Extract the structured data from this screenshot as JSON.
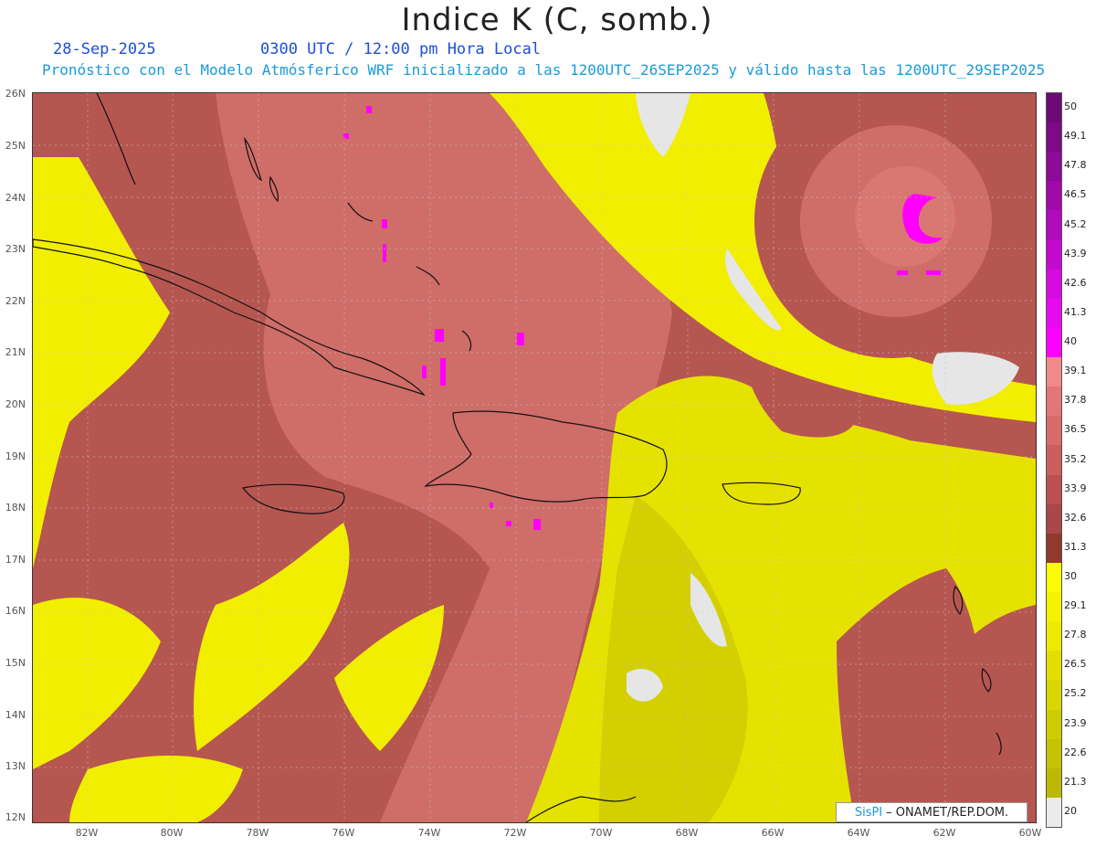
{
  "header": {
    "title": "Indice K (C, somb.)",
    "date": "28-Sep-2025",
    "time": "0300 UTC / 12:00 pm Hora Local",
    "forecast": "Pronóstico con el Modelo Atmósferico WRF inicializado a las 1200UTC_26SEP2025 y válido hasta las  1200UTC_29SEP2025"
  },
  "axes": {
    "lat_labels": [
      "26N",
      "25N",
      "24N",
      "23N",
      "22N",
      "21N",
      "20N",
      "19N",
      "18N",
      "17N",
      "16N",
      "15N",
      "14N",
      "13N",
      "12N"
    ],
    "lon_labels": [
      "82W",
      "80W",
      "78W",
      "76W",
      "74W",
      "72W",
      "70W",
      "68W",
      "66W",
      "64W",
      "62W",
      "60W"
    ]
  },
  "colorbar": {
    "labels": [
      "50",
      "49.1",
      "47.8",
      "46.5",
      "45.2",
      "43.9",
      "42.6",
      "41.3",
      "40",
      "39.1",
      "37.8",
      "36.5",
      "35.2",
      "33.9",
      "32.6",
      "31.3",
      "30",
      "29.1",
      "27.8",
      "26.5",
      "25.2",
      "23.9",
      "22.6",
      "21.3",
      "20"
    ],
    "colors": [
      "#6e0a78",
      "#7d0a86",
      "#8e0a98",
      "#a00aaa",
      "#b20abd",
      "#c50ad0",
      "#d70ae0",
      "#e70af0",
      "#ff00ff",
      "#f08a8a",
      "#e37676",
      "#d96a6a",
      "#cc5e5e",
      "#bc5050",
      "#a84848",
      "#8f3a2a",
      "#fffb00",
      "#f5f200",
      "#ecea00",
      "#e2df00",
      "#d9d600",
      "#cfcc00",
      "#c6c200",
      "#bdb900",
      "#ebebeb"
    ]
  },
  "credit": {
    "brand": "SisPI",
    "text": "– ONAMET/REP.DOM."
  }
}
